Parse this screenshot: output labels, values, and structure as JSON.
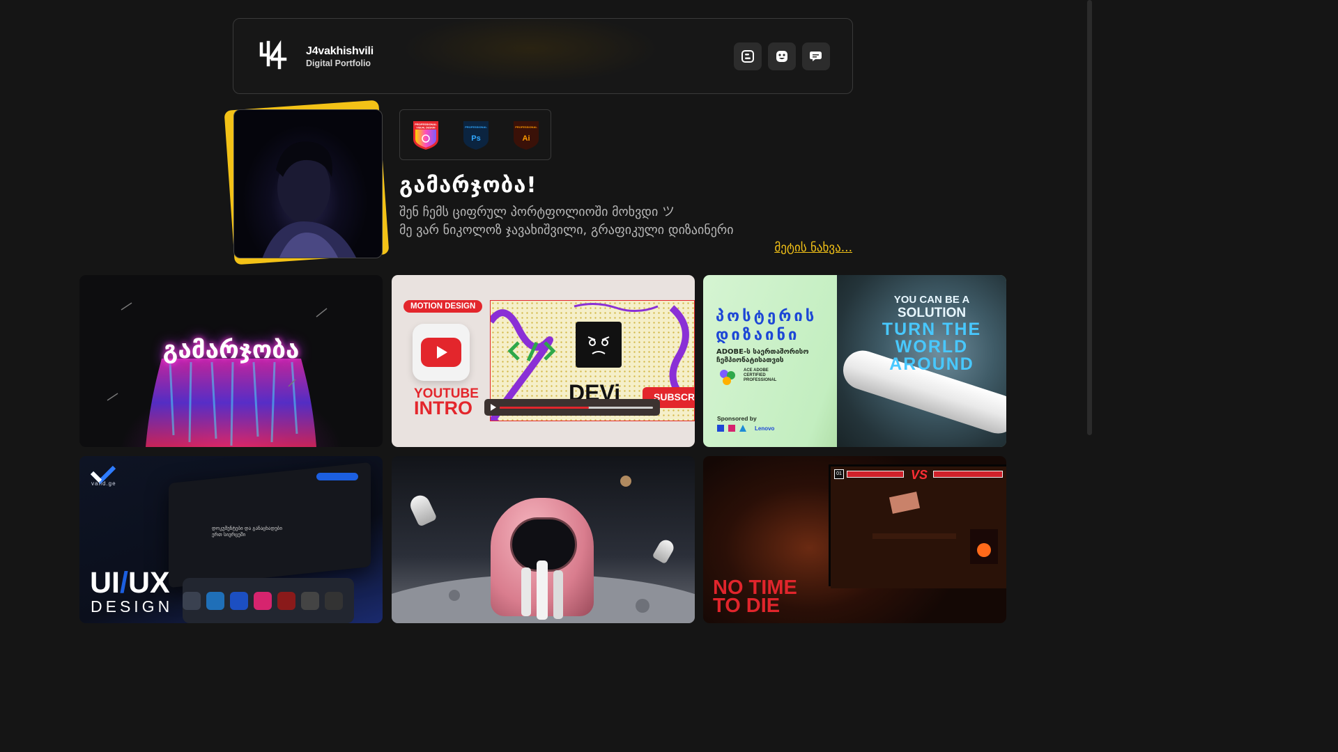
{
  "header": {
    "brand_name": "J4vakhishvili",
    "brand_subtitle": "Digital Portfolio",
    "buttons": [
      {
        "icon": "blogger-icon"
      },
      {
        "icon": "face-icon"
      },
      {
        "icon": "chat-icon"
      }
    ]
  },
  "profile": {
    "badges": [
      {
        "icon": "visual-design-badge-icon",
        "label": "PROFESSIONAL VISUAL DESIGN",
        "color": "#e6282f"
      },
      {
        "icon": "photoshop-badge-icon",
        "label": "PROFESSIONAL",
        "sublabel": "Ps",
        "color": "#31a8ff"
      },
      {
        "icon": "illustrator-badge-icon",
        "label": "PROFESSIONAL",
        "sublabel": "Ai",
        "color": "#ff9a00"
      }
    ],
    "greeting": "გამარჯობა!",
    "line1": "შენ ჩემს ციფრულ პორტფოლიოში მოხვდი ツ",
    "line2": "მე ვარ ნიკოლოზ ჯავახიშვილი, გრაფიკული დიზაინერი",
    "more_link": "მეტის ნახვა..."
  },
  "cards": [
    {
      "id": "greeting-art",
      "title": "გამარჯობა"
    },
    {
      "id": "youtube-intro",
      "tag": "MOTION DESIGN",
      "word1": "YOUTUBE",
      "word2": "INTRO",
      "thumb_title": "DEVi",
      "subscribe": "SUBSCRI"
    },
    {
      "id": "poster-design",
      "title": "პოსტერის დიზაინი",
      "subtitle": "ADOBE-ს საერთაშორისო ჩემპიონატისათვის",
      "cert": "ACE ADOBE CERTIFIED PROFESSIONAL",
      "sponsored": "Sponsored by",
      "sponsor": "Lenovo",
      "slogan_1": "YOU CAN BE A",
      "slogan_2": "SOLUTION",
      "slogan_3": "TURN THE",
      "slogan_4": "WORLD",
      "slogan_5": "AROUND"
    },
    {
      "id": "uiux-design",
      "logo_text": "valid.ge",
      "mock_text": "დოკუმენტები და განაცხადები ერთ სივრცეში",
      "big": "UI",
      "slash": "/",
      "big2": "UX",
      "small": "DESIGN"
    },
    {
      "id": "astronaut-chess"
    },
    {
      "id": "no-time-to-die",
      "title_1": "NO TIME",
      "title_2": "TO DIE",
      "vs": "VS",
      "hud_left": "01"
    }
  ],
  "colors": {
    "accent": "#f3c217",
    "background": "#151515",
    "youtube_red": "#e3262c",
    "poster_blue": "#1d47d6"
  }
}
